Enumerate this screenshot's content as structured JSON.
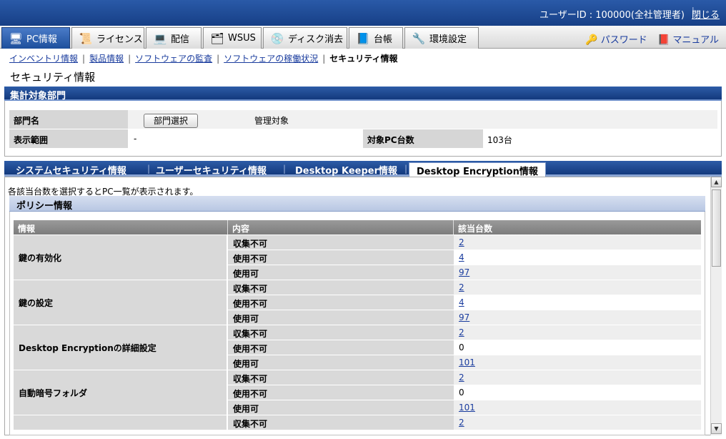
{
  "topbar": {
    "user": "ユーザーID : 100000(全社管理者)",
    "close": "閉じる"
  },
  "maintabs": [
    {
      "label": "PC情報",
      "icon": "pc-icon",
      "active": true
    },
    {
      "label": "ライセンス",
      "icon": "license-icon"
    },
    {
      "label": "配信",
      "icon": "distribution-icon"
    },
    {
      "label": "WSUS",
      "icon": "wsus-icon"
    },
    {
      "label": "ディスク消去",
      "icon": "disk-erase-icon"
    },
    {
      "label": "台帳",
      "icon": "ledger-icon"
    },
    {
      "label": "環境設定",
      "icon": "settings-icon"
    }
  ],
  "rightlinks": {
    "password": "パスワード",
    "manual": "マニュアル"
  },
  "subnav": {
    "inventory": "インベントリ情報",
    "product": "製品情報",
    "audit": "ソフトウェアの監査",
    "usage": "ソフトウェアの稼働状況",
    "current": "セキュリティ情報"
  },
  "page_title": "セキュリティ情報",
  "dept_section": {
    "title": "集計対象部門",
    "dept_label": "部門名",
    "dept_button": "部門選択",
    "dept_value": "管理対象",
    "range_label": "表示範囲",
    "range_value": "-",
    "pc_count_label": "対象PC台数",
    "pc_count_value": "103台"
  },
  "subtabs": [
    {
      "label": "システムセキュリティ情報"
    },
    {
      "label": "ユーザーセキュリティ情報"
    },
    {
      "label": "Desktop Keeper情報"
    },
    {
      "label": "Desktop Encryption情報",
      "active": true
    }
  ],
  "hint": "各該当台数を選択するとPC一覧が表示されます。",
  "policy": {
    "title": "ポリシー情報",
    "columns": [
      "情報",
      "内容",
      "該当台数"
    ],
    "groups": [
      {
        "name": "鍵の有効化",
        "rows": [
          {
            "k": "収集不可",
            "v": "2",
            "link": true
          },
          {
            "k": "使用不可",
            "v": "4",
            "link": true
          },
          {
            "k": "使用可",
            "v": "97",
            "link": true
          }
        ]
      },
      {
        "name": "鍵の設定",
        "rows": [
          {
            "k": "収集不可",
            "v": "2",
            "link": true
          },
          {
            "k": "使用不可",
            "v": "4",
            "link": true
          },
          {
            "k": "使用可",
            "v": "97",
            "link": true
          }
        ]
      },
      {
        "name": "Desktop Encryptionの詳細設定",
        "rows": [
          {
            "k": "収集不可",
            "v": "2",
            "link": true
          },
          {
            "k": "使用不可",
            "v": "0",
            "link": false
          },
          {
            "k": "使用可",
            "v": "101",
            "link": true
          }
        ]
      },
      {
        "name": "自動暗号フォルダ",
        "rows": [
          {
            "k": "収集不可",
            "v": "2",
            "link": true
          },
          {
            "k": "使用不可",
            "v": "0",
            "link": false
          },
          {
            "k": "使用可",
            "v": "101",
            "link": true
          }
        ]
      },
      {
        "name": "",
        "rows": [
          {
            "k": "収集不可",
            "v": "2",
            "link": true
          }
        ]
      }
    ]
  }
}
